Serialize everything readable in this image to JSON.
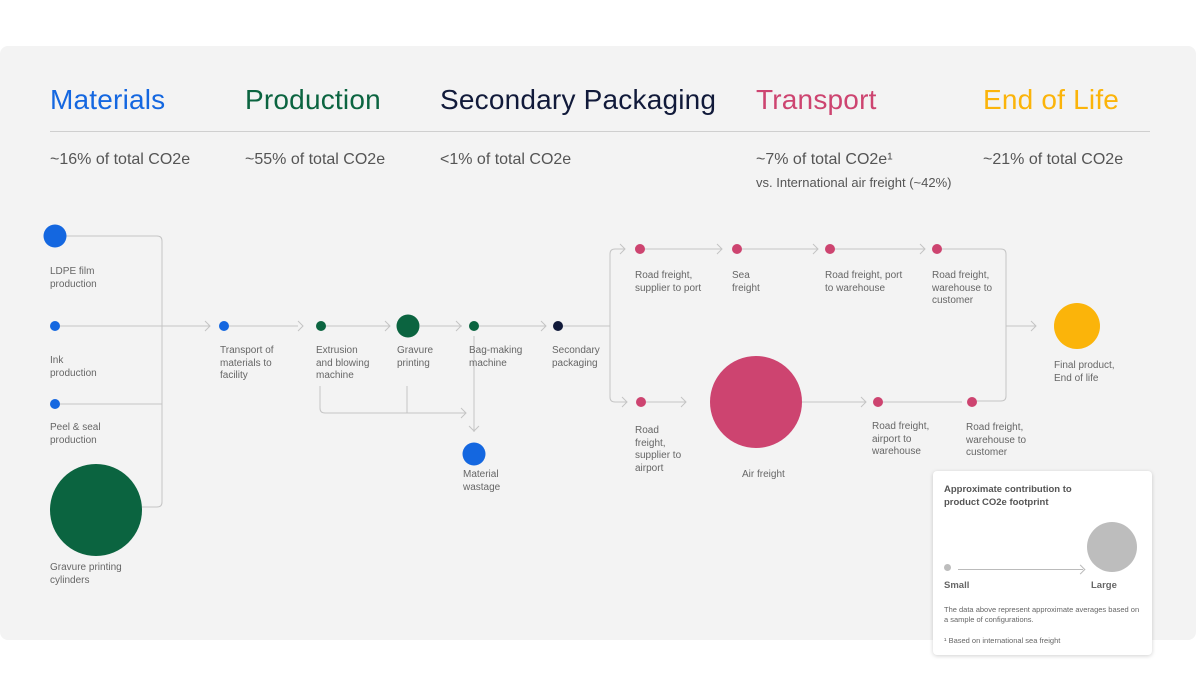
{
  "colors": {
    "materials": "#1467e0",
    "production": "#0b6440",
    "secondary_packaging": "#111a3a",
    "transport": "#cd4470",
    "end_of_life": "#fbb40a",
    "line": "#c4c4c4"
  },
  "stages": [
    {
      "key": "materials",
      "title": "Materials",
      "share": "~16% of total CO2e",
      "note": ""
    },
    {
      "key": "production",
      "title": "Production",
      "share": "~55% of total CO2e",
      "note": ""
    },
    {
      "key": "secondary_packaging",
      "title": "Secondary Packaging",
      "share": "<1% of total CO2e",
      "note": ""
    },
    {
      "key": "transport",
      "title": "Transport",
      "share": "~7% of total CO2e¹",
      "note": "vs. International air freight (~42%)"
    },
    {
      "key": "end_of_life",
      "title": "End of Life",
      "share": "~21% of total CO2e",
      "note": ""
    }
  ],
  "nodes": [
    {
      "id": "ldpe",
      "stage": "materials",
      "label": [
        "LDPE film",
        "production"
      ]
    },
    {
      "id": "ink",
      "stage": "materials",
      "label": [
        "Ink",
        "production"
      ]
    },
    {
      "id": "peel",
      "stage": "materials",
      "label": [
        "Peel & seal",
        "production"
      ]
    },
    {
      "id": "cylinders",
      "stage": "production",
      "label": [
        "Gravure printing",
        "cylinders"
      ]
    },
    {
      "id": "transport_facility",
      "stage": "materials",
      "label": [
        "Transport of",
        "materials to",
        "facility"
      ]
    },
    {
      "id": "extrusion",
      "stage": "production",
      "label": [
        "Extrusion",
        "and blowing",
        "machine"
      ]
    },
    {
      "id": "gravure",
      "stage": "production",
      "label": [
        "Gravure",
        "printing"
      ]
    },
    {
      "id": "bagmaking",
      "stage": "production",
      "label": [
        "Bag-making",
        "machine"
      ]
    },
    {
      "id": "wastage",
      "stage": "materials",
      "label": [
        "Material",
        "wastage"
      ]
    },
    {
      "id": "secondary",
      "stage": "secondary_packaging",
      "label": [
        "Secondary",
        "packaging"
      ]
    },
    {
      "id": "road_port",
      "stage": "transport",
      "label": [
        "Road freight,",
        "supplier to port"
      ]
    },
    {
      "id": "sea",
      "stage": "transport",
      "label": [
        "Sea",
        "freight"
      ]
    },
    {
      "id": "road_port_wh",
      "stage": "transport",
      "label": [
        "Road freight, port",
        "to warehouse"
      ]
    },
    {
      "id": "road_wh_cust_top",
      "stage": "transport",
      "label": [
        "Road freight,",
        "warehouse to",
        "customer"
      ]
    },
    {
      "id": "road_airport",
      "stage": "transport",
      "label": [
        "Road",
        "freight,",
        "supplier to",
        "airport"
      ]
    },
    {
      "id": "air",
      "stage": "transport",
      "label": [
        "Air freight"
      ]
    },
    {
      "id": "road_airport_wh",
      "stage": "transport",
      "label": [
        "Road freight,",
        "airport to",
        "warehouse"
      ]
    },
    {
      "id": "road_wh_cust_bot",
      "stage": "transport",
      "label": [
        "Road freight,",
        "warehouse to",
        "customer"
      ]
    },
    {
      "id": "final",
      "stage": "end_of_life",
      "label": [
        "Final product,",
        "End of life"
      ]
    }
  ],
  "legend": {
    "title": "Approximate contribution to product CO2e footprint",
    "small": "Small",
    "large": "Large",
    "note": "The data above represent approximate averages based on a sample of configurations.",
    "footnote": "¹ Based on international sea freight"
  }
}
